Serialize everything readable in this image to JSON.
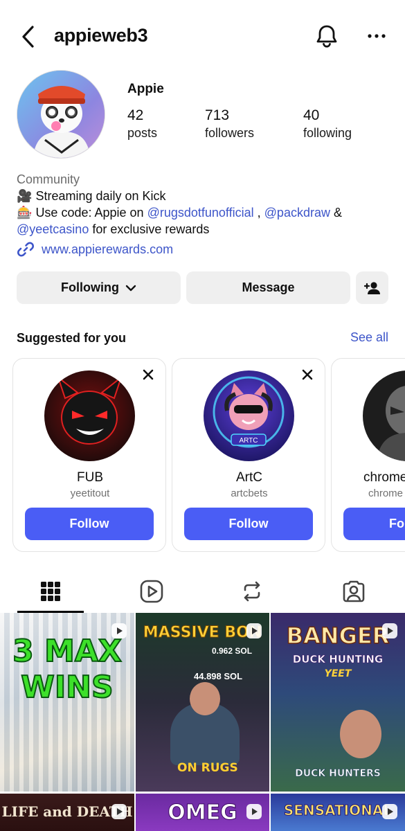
{
  "header": {
    "username": "appieweb3"
  },
  "profile": {
    "display_name": "Appie",
    "stats": [
      {
        "value": "42",
        "label": "posts"
      },
      {
        "value": "713",
        "label": "followers"
      },
      {
        "value": "40",
        "label": "following"
      }
    ],
    "bio": {
      "category": "Community",
      "line1_emoji": "🎥",
      "line1": "Streaming daily on Kick",
      "line2_emoji": "🎰",
      "line2_pre": "Use code: Appie on",
      "mention1": "@rugsdotfunofficial",
      "sep1": ",",
      "mention2": "@packdraw",
      "sep2": "&",
      "mention3": "@yeetcasino",
      "line3_post": "for exclusive rewards"
    },
    "link": "www.appierewards.com"
  },
  "actions": {
    "following_label": "Following",
    "message_label": "Message"
  },
  "suggested": {
    "title": "Suggested for you",
    "see_all": "See all",
    "cards": [
      {
        "name": "FUB",
        "handle": "yeetitout",
        "button": "Follow"
      },
      {
        "name": "ArtC",
        "handle": "artcbets",
        "button": "Follow",
        "badge": "ARTC"
      },
      {
        "name": "chrome",
        "handle": "chrome",
        "button": "Fol"
      }
    ]
  },
  "posts": [
    {
      "text": "3 MAX WINS"
    },
    {
      "text": "MASSIVE BON",
      "sub1": "0.962 SOL",
      "sub2": "44.898 SOL",
      "sub3": "ON RUGS"
    },
    {
      "text": "BANGER",
      "sub1": "DUCK HUNTING",
      "sub2": "YEET",
      "sub3": "DUCK HUNTERS"
    },
    {
      "text": "LIFE and DEATH"
    },
    {
      "text": "OMEG"
    },
    {
      "text": "SENSATIONAL"
    }
  ]
}
